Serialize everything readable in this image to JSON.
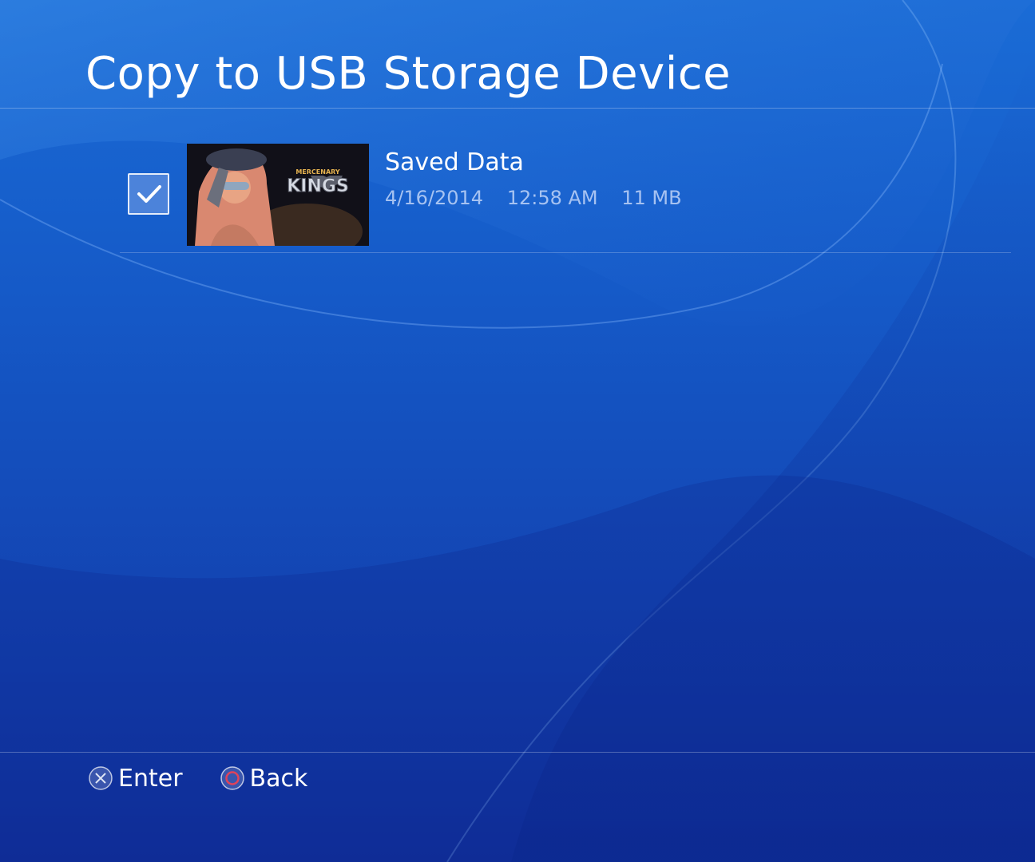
{
  "header": {
    "title": "Copy to USB Storage Device"
  },
  "items": [
    {
      "checked": true,
      "thumbnail_logo_top": "MERCENARY",
      "thumbnail_logo_main": "KINGS",
      "name": "Saved Data",
      "date": "4/16/2014",
      "time": "12:58 AM",
      "size": "11 MB"
    }
  ],
  "footer": {
    "enter_label": "Enter",
    "enter_icon": "cross-button-icon",
    "back_label": "Back",
    "back_icon": "circle-button-icon"
  },
  "colors": {
    "background_top": "#1a6cd6",
    "background_bottom": "#102f9a",
    "circle_button": "#e0435a"
  }
}
